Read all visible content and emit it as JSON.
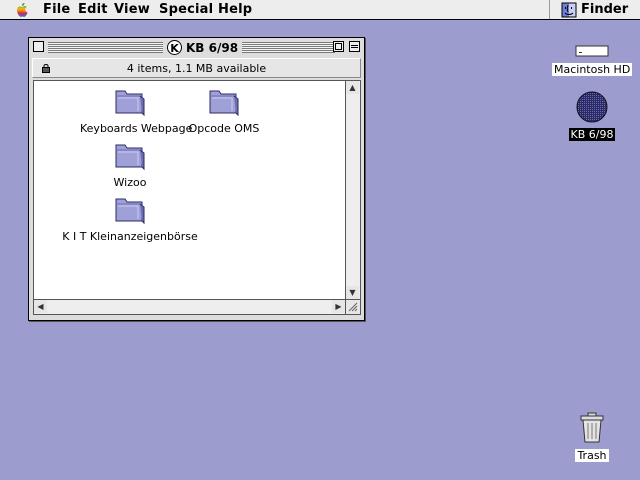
{
  "menubar": {
    "apple": "apple-menu",
    "items": [
      "File",
      "Edit",
      "View",
      "Special",
      "Help"
    ],
    "app_name": "Finder"
  },
  "window": {
    "title": "KB 6/98",
    "title_icon_letter": "K",
    "info": "4 items, 1.1 MB available",
    "items": [
      {
        "name": "Keyboards Webpage"
      },
      {
        "name": "Opcode OMS"
      },
      {
        "name": "Wizoo"
      },
      {
        "name": "K I T Kleinanzeigenbörse"
      }
    ]
  },
  "desktop": {
    "icons": [
      {
        "name": "Macintosh HD",
        "selected": false
      },
      {
        "name": "KB 6/98",
        "selected": true
      },
      {
        "name": "Trash",
        "selected": false
      }
    ]
  },
  "colors": {
    "desktop": "#9C9CCE",
    "folder": "#9FA0D8",
    "selection": "#000000"
  }
}
